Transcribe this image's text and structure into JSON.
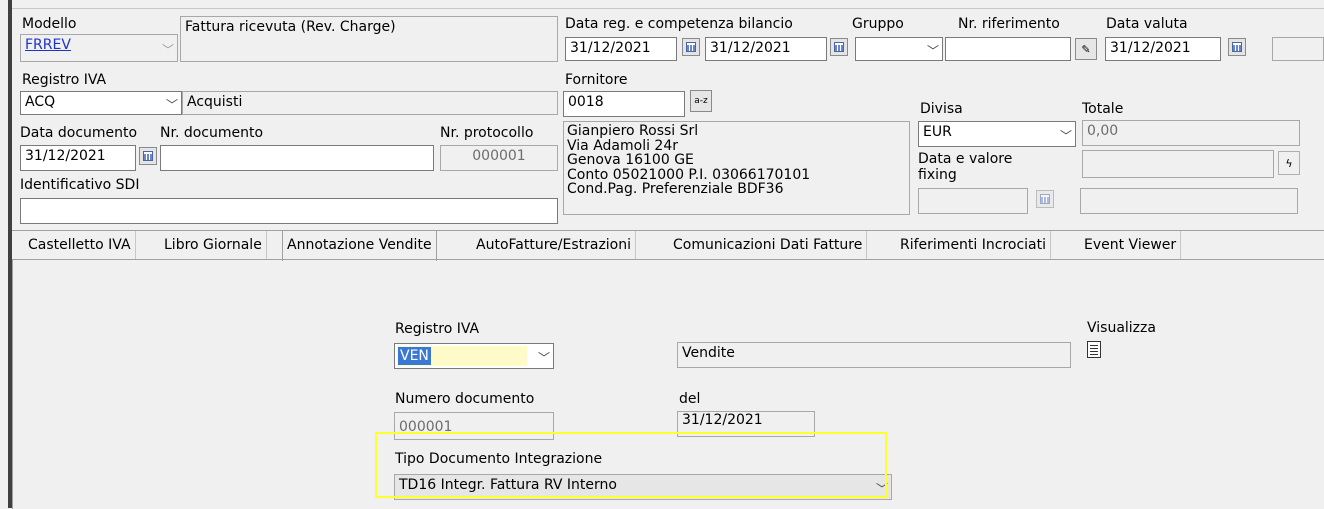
{
  "header": {
    "modello_label": "Modello",
    "modello_value": "FRREV",
    "modello_desc": "Fattura ricevuta (Rev. Charge)",
    "data_reg_label": "Data reg. e competenza bilancio",
    "data_reg_value": "31/12/2021",
    "data_comp_value": "31/12/2021",
    "gruppo_label": "Gruppo",
    "nr_riferimento_label": "Nr. riferimento",
    "data_valuta_label": "Data valuta",
    "data_valuta_value": "31/12/2021",
    "registro_iva_label": "Registro IVA",
    "registro_iva_value": "ACQ",
    "registro_iva_desc": "Acquisti",
    "fornitore_label": "Fornitore",
    "fornitore_value": "0018",
    "data_documento_label": "Data documento",
    "data_documento_value": "31/12/2021",
    "nr_documento_label": "Nr. documento",
    "nr_protocollo_label": "Nr. protocollo",
    "nr_protocollo_value": "000001",
    "identificativo_sdi_label": "Identificativo SDI",
    "fornitore_info": [
      "Gianpiero Rossi Srl",
      "Via Adamoli 24r",
      "Genova 16100 GE",
      "Conto 05021000 P.I. 03066170101",
      "Cond.Pag. Preferenziale BDF36"
    ],
    "divisa_label": "Divisa",
    "divisa_value": "EUR",
    "totale_label": "Totale",
    "totale_value": "0,00",
    "fixing_label_1": "Data e valore",
    "fixing_label_2": "fixing"
  },
  "tabs": [
    {
      "label": "Castelletto IVA"
    },
    {
      "label": "Libro Giornale"
    },
    {
      "label": "Annotazione Vendite"
    },
    {
      "label": "AutoFatture/Estrazioni"
    },
    {
      "label": "Comunicazioni Dati Fatture"
    },
    {
      "label": "Riferimenti Incrociati"
    },
    {
      "label": "Event Viewer"
    }
  ],
  "vendite": {
    "registro_iva_label": "Registro IVA",
    "registro_iva_value": "VEN",
    "registro_iva_desc": "Vendite",
    "visualizza_label": "Visualizza",
    "numero_documento_label": "Numero documento",
    "numero_documento_value": "000001",
    "del_label": "del",
    "del_value": "31/12/2021",
    "tipo_doc_label": "Tipo Documento Integrazione",
    "tipo_doc_value": "TD16 Integr. Fattura RV Interno"
  },
  "colors": {
    "highlight": "#ffff30",
    "selection": "#3a78d6",
    "link": "#1f33c9"
  }
}
